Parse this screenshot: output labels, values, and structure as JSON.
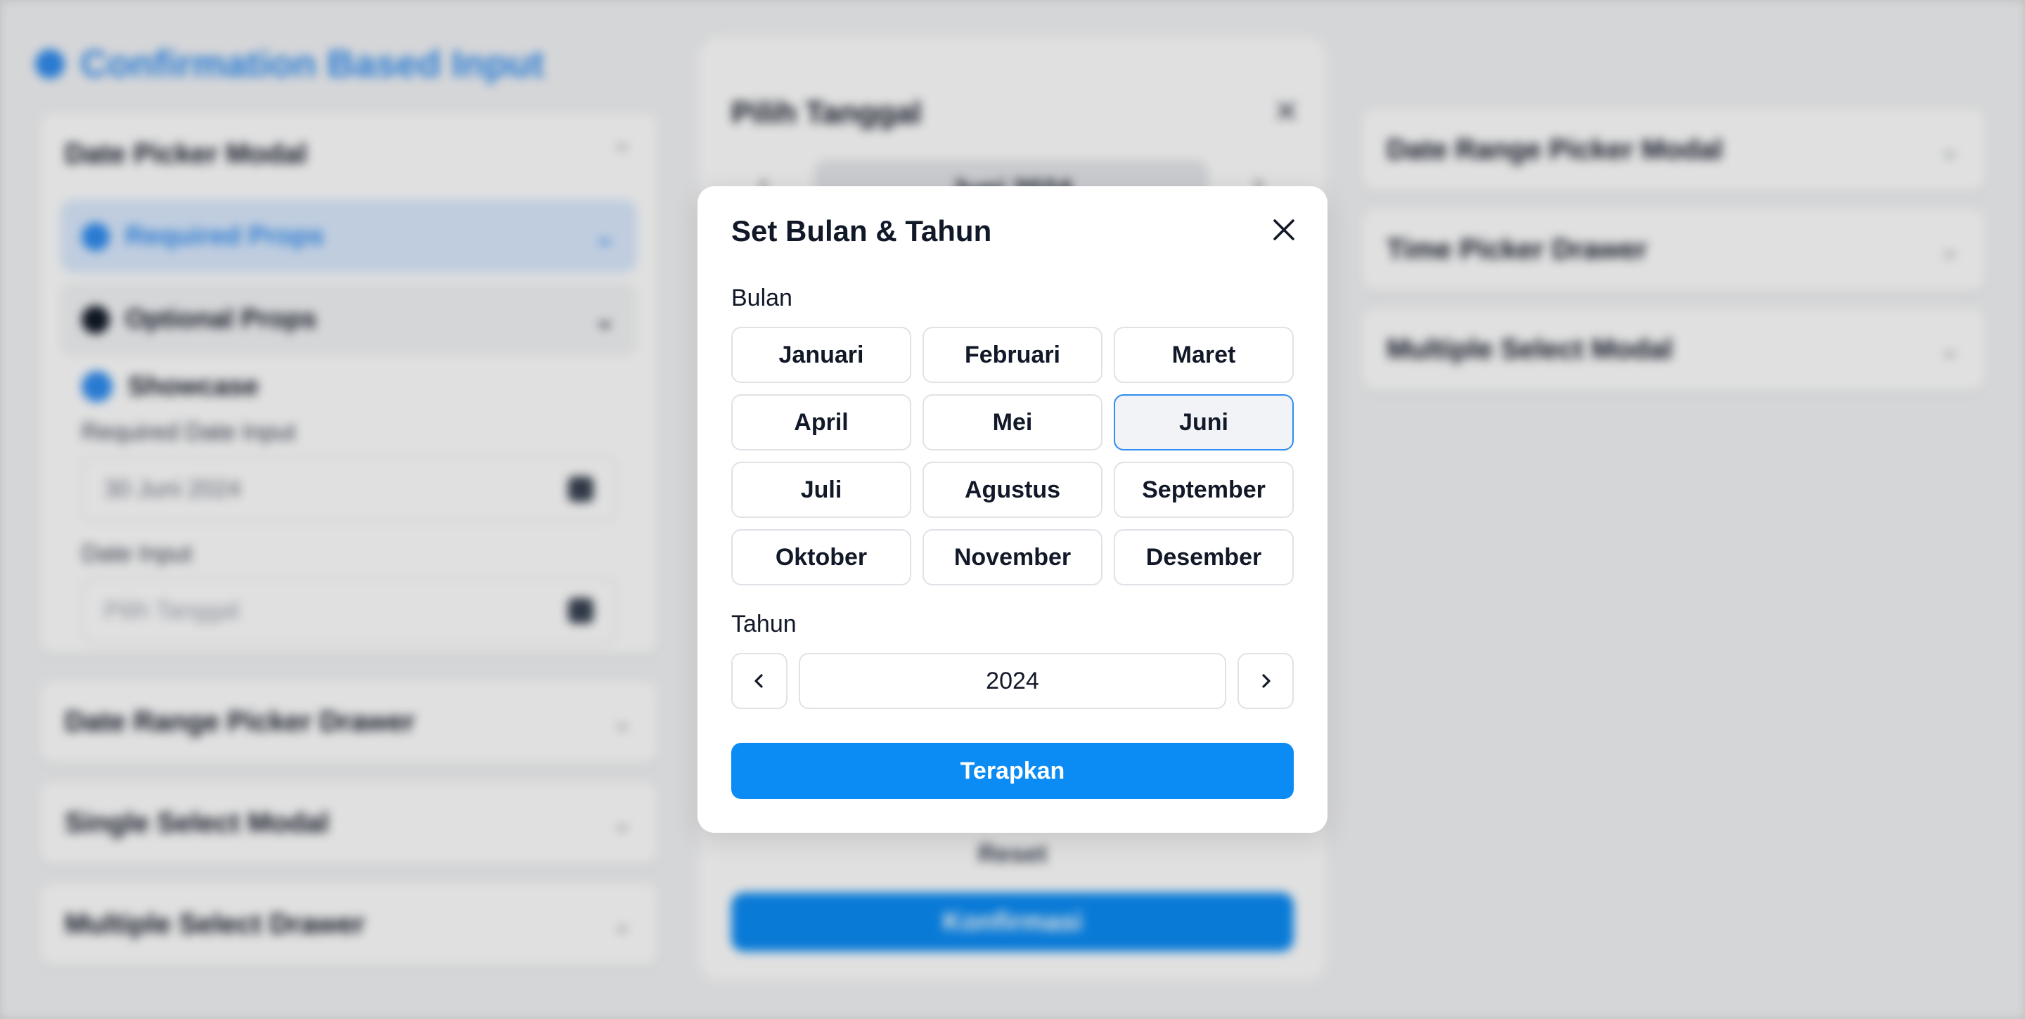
{
  "background": {
    "page_title": "Confirmation Based Input",
    "left_cards": [
      {
        "title": "Date Picker Modal"
      },
      {
        "title": "Date Range Picker Drawer"
      },
      {
        "title": "Single Select Modal"
      },
      {
        "title": "Multiple Select Drawer"
      }
    ],
    "right_cards": [
      {
        "title": "Date Range Picker Modal"
      },
      {
        "title": "Time Picker Drawer"
      },
      {
        "title": "Multiple Select Modal"
      }
    ],
    "props_tabs": [
      {
        "label": "Required Props"
      },
      {
        "label": "Optional Props"
      }
    ],
    "showcase_label": "Showcase",
    "fields": [
      {
        "label": "Required Date Input",
        "value": "30 Juni 2024"
      },
      {
        "label": "Date Input",
        "placeholder": "Pilih Tanggal"
      }
    ],
    "picker": {
      "title": "Pilih Tanggal",
      "month_label": "Juni 2024",
      "reset_label": "Reset",
      "confirm_label": "Konfirmasi"
    }
  },
  "modal": {
    "title": "Set Bulan & Tahun",
    "month_section_label": "Bulan",
    "months": [
      "Januari",
      "Februari",
      "Maret",
      "April",
      "Mei",
      "Juni",
      "Juli",
      "Agustus",
      "September",
      "Oktober",
      "November",
      "Desember"
    ],
    "selected_month": "Juni",
    "year_section_label": "Tahun",
    "year": "2024",
    "apply_label": "Terapkan"
  },
  "colors": {
    "accent": "#0b8cf5",
    "selected_border": "#2f8cf0"
  }
}
